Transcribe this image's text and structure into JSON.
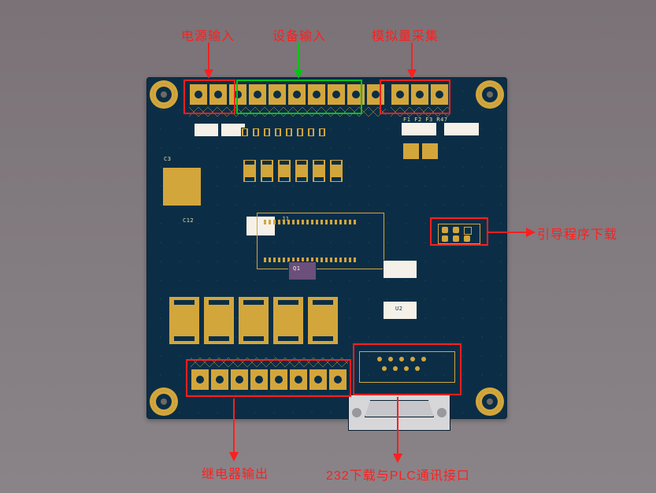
{
  "labels": {
    "power_in": "电源输入",
    "device_in": "设备输入",
    "analog_in": "模拟量采集",
    "boot_dl": "引导程序下载",
    "relay_out": "继电器输出",
    "rs232": "232下载与PLC通讯接口"
  },
  "silk": {
    "q1": "Q1",
    "j1": "J1",
    "u2": "U2",
    "c12": "C12",
    "c3": "C3",
    "f_row": "F1 F2 F3  R47"
  }
}
